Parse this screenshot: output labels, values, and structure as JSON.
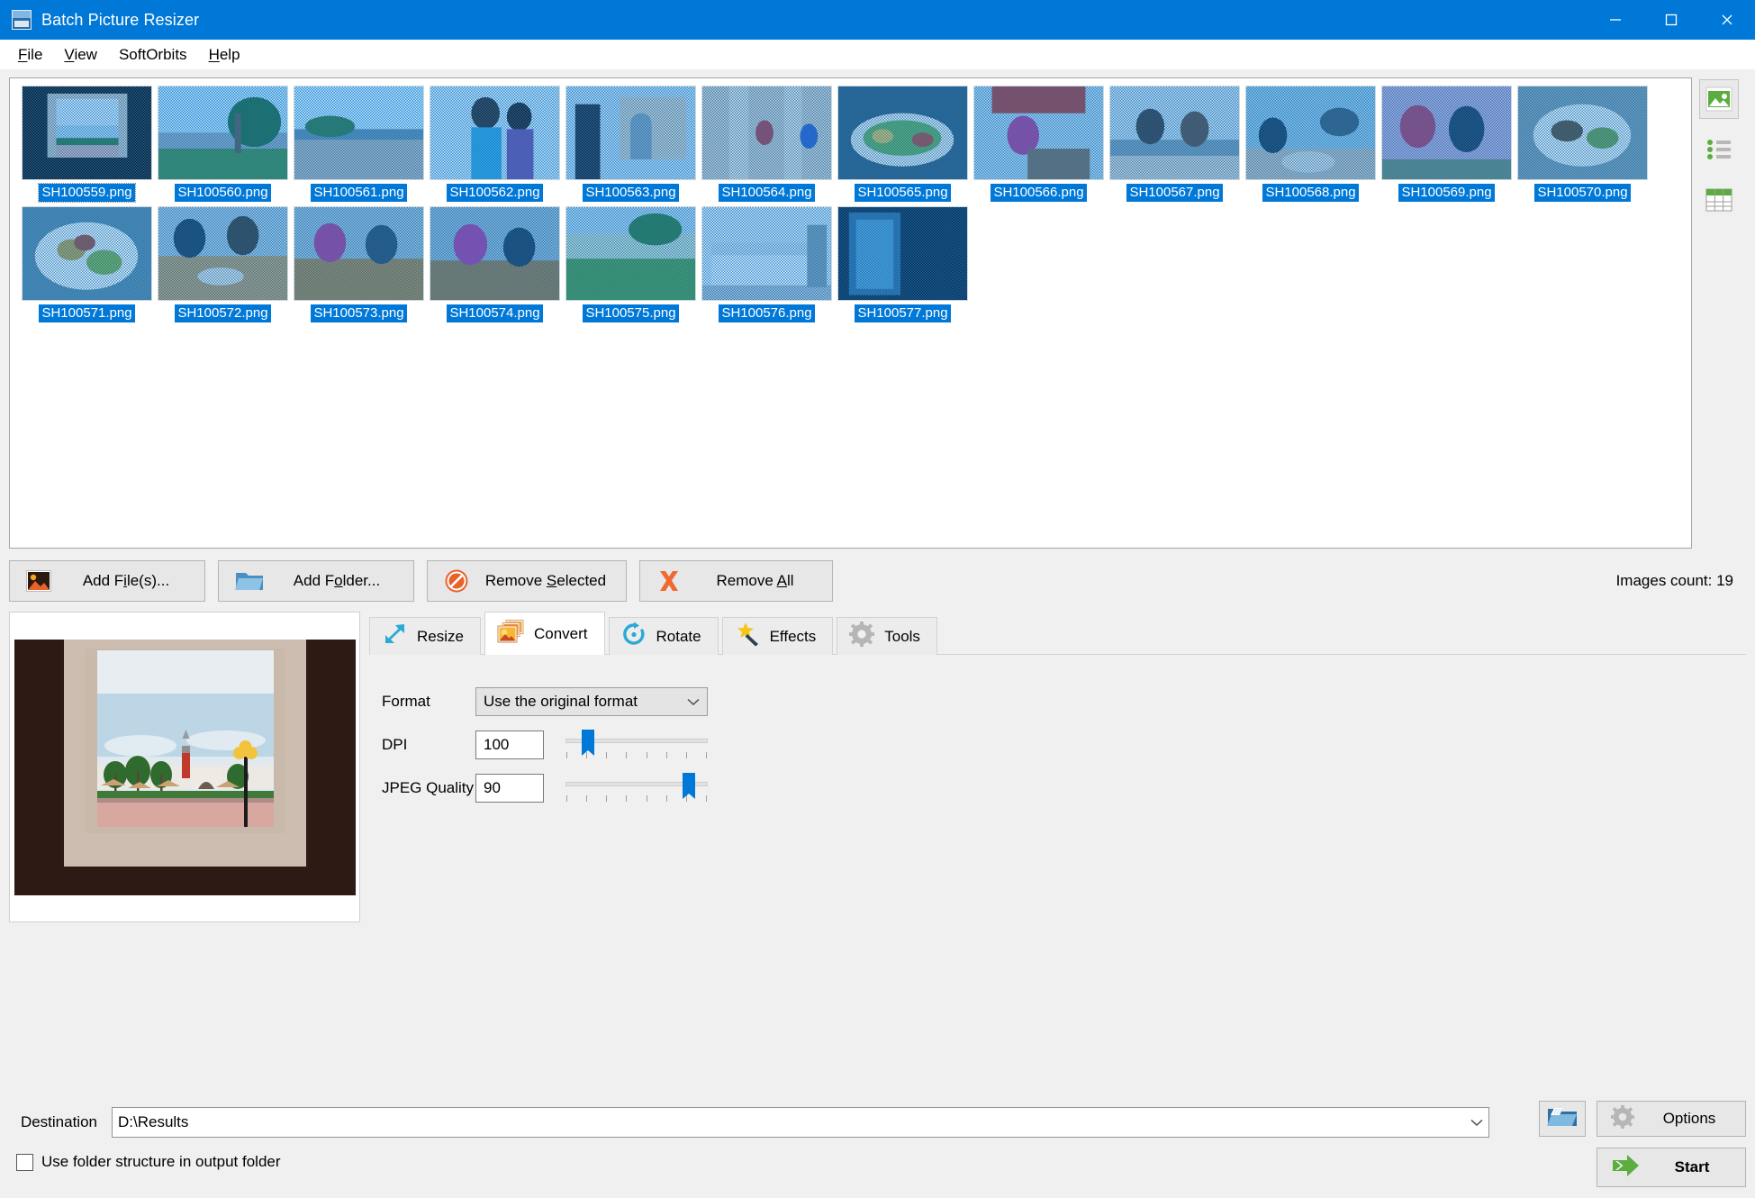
{
  "window": {
    "title": "Batch Picture Resizer",
    "icon": "app-icon",
    "minimize": "minimize-icon",
    "maximize": "maximize-icon",
    "close": "close-icon"
  },
  "menu": [
    {
      "label": "File",
      "accel": "F"
    },
    {
      "label": "View",
      "accel": "V"
    },
    {
      "label": "SoftOrbits",
      "accel": ""
    },
    {
      "label": "Help",
      "accel": "H"
    }
  ],
  "thumbnails": [
    {
      "name": "SH100559.png",
      "selected": true,
      "focused": true
    },
    {
      "name": "SH100560.png",
      "selected": true,
      "focused": false
    },
    {
      "name": "SH100561.png",
      "selected": true,
      "focused": false
    },
    {
      "name": "SH100562.png",
      "selected": true,
      "focused": false
    },
    {
      "name": "SH100563.png",
      "selected": true,
      "focused": false
    },
    {
      "name": "SH100564.png",
      "selected": true,
      "focused": false
    },
    {
      "name": "SH100565.png",
      "selected": true,
      "focused": false
    },
    {
      "name": "SH100566.png",
      "selected": true,
      "focused": false
    },
    {
      "name": "SH100567.png",
      "selected": true,
      "focused": false
    },
    {
      "name": "SH100568.png",
      "selected": true,
      "focused": false
    },
    {
      "name": "SH100569.png",
      "selected": true,
      "focused": false
    },
    {
      "name": "SH100570.png",
      "selected": true,
      "focused": false
    },
    {
      "name": "SH100571.png",
      "selected": true,
      "focused": false
    },
    {
      "name": "SH100572.png",
      "selected": true,
      "focused": false
    },
    {
      "name": "SH100573.png",
      "selected": true,
      "focused": false
    },
    {
      "name": "SH100574.png",
      "selected": true,
      "focused": false
    },
    {
      "name": "SH100575.png",
      "selected": true,
      "focused": false
    },
    {
      "name": "SH100576.png",
      "selected": true,
      "focused": false
    },
    {
      "name": "SH100577.png",
      "selected": true,
      "focused": false
    }
  ],
  "view_modes": [
    {
      "name": "thumbnails-view",
      "icon": "image-thumbnail-icon",
      "active": true
    },
    {
      "name": "list-view",
      "icon": "bullet-list-icon",
      "active": false
    },
    {
      "name": "details-view",
      "icon": "table-grid-icon",
      "active": false
    }
  ],
  "actions": {
    "add_files": "Add File(s)...",
    "add_files_accel": "i",
    "add_folder": "Add Folder...",
    "add_folder_accel": "o",
    "remove_selected": "Remove Selected",
    "remove_selected_accel": "S",
    "remove_all": "Remove All",
    "remove_all_accel": "A",
    "images_count": "Images count: 19"
  },
  "tabs": [
    {
      "label": "Resize",
      "icon": "resize-arrows-icon",
      "active": false
    },
    {
      "label": "Convert",
      "icon": "convert-images-icon",
      "active": true
    },
    {
      "label": "Rotate",
      "icon": "rotate-circular-arrow-icon",
      "active": false
    },
    {
      "label": "Effects",
      "icon": "magic-wand-icon",
      "active": false
    },
    {
      "label": "Tools",
      "icon": "gear-icon",
      "active": false
    }
  ],
  "convert": {
    "format_label": "Format",
    "format_value": "Use the original format",
    "dpi_label": "DPI",
    "dpi_value": "100",
    "dpi_slider_percent": 16,
    "jpeg_label": "JPEG Quality",
    "jpeg_value": "90",
    "jpeg_slider_percent": 87
  },
  "bottom": {
    "destination_label": "Destination",
    "destination_value": "D:\\Results",
    "browse_icon": "open-folder-icon",
    "options_label": "Options",
    "options_icon": "gear-icon",
    "start_label": "Start",
    "start_icon": "green-arrow-icon",
    "checkbox_label": "Use folder structure in output folder",
    "checkbox_checked": false
  },
  "colors": {
    "titlebar": "#0078d7",
    "selection": "#0078d7",
    "accent_green": "#5bad3f",
    "accent_orange": "#e8622a",
    "panel": "#f0f0f0"
  }
}
